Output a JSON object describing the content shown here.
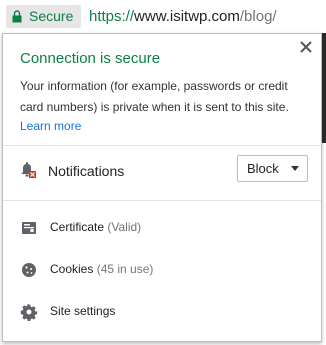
{
  "omnibox": {
    "secure_label": "Secure",
    "url_scheme": "https://",
    "url_host": "www.isitwp.com",
    "url_path": "/blog/"
  },
  "popup": {
    "title": "Connection is secure",
    "description": "Your information (for example, passwords or credit card numbers) is private when it is sent to this site.",
    "learn_more": "Learn more",
    "permissions": [
      {
        "label": "Notifications",
        "value": "Block",
        "icon": "notifications-blocked-icon"
      }
    ],
    "menu": [
      {
        "label": "Certificate",
        "sub": "(Valid)",
        "icon": "certificate-icon"
      },
      {
        "label": "Cookies",
        "sub": "(45 in use)",
        "icon": "cookie-icon"
      },
      {
        "label": "Site settings",
        "sub": "",
        "icon": "gear-icon"
      }
    ]
  },
  "colors": {
    "secure_green": "#0b8043",
    "link_blue": "#1a73e8"
  }
}
